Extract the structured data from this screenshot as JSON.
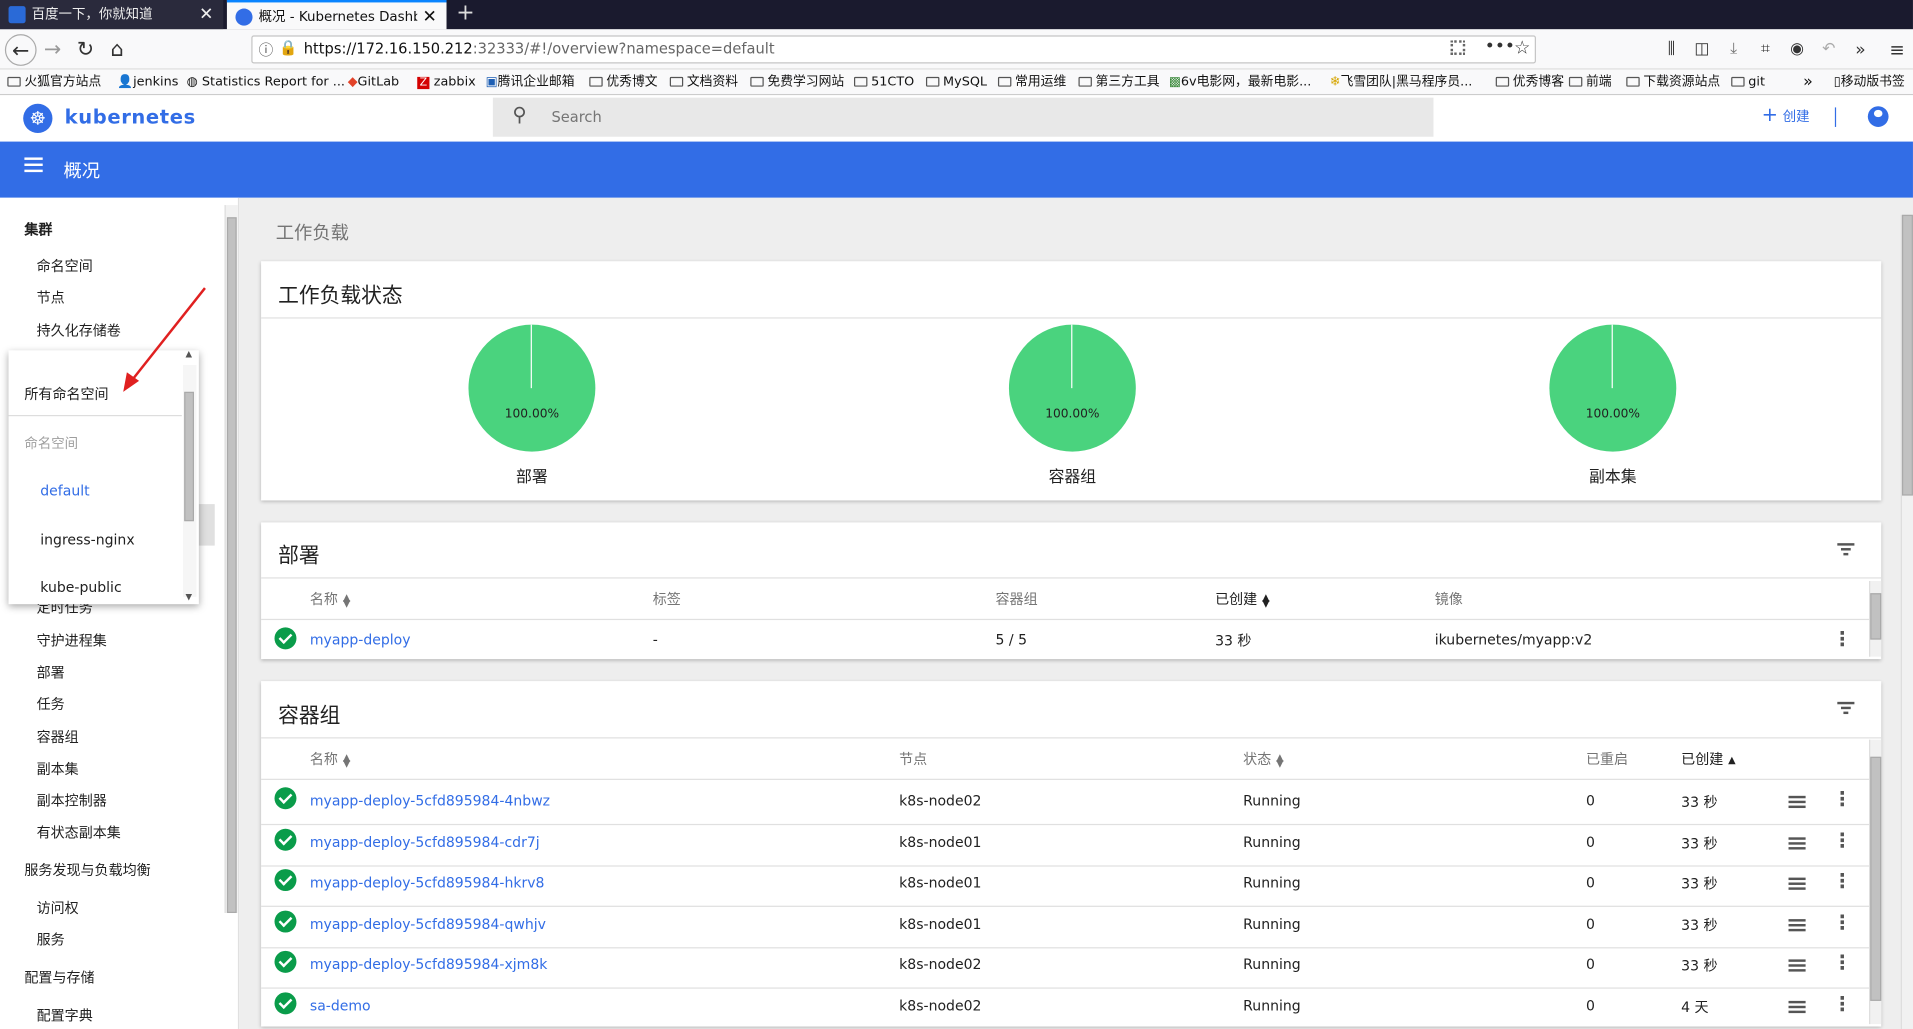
{
  "browser": {
    "tabs": [
      {
        "label": "百度一下，你就知道",
        "active": false
      },
      {
        "label": "概况 - Kubernetes Dashboard",
        "active": true
      }
    ],
    "url_host": "https://172.16.150.212",
    "url_rest": ":32333/#!/overview?namespace=default",
    "bookmarks": [
      "火狐官方站点",
      "jenkins",
      "Statistics Report for ...",
      "GitLab",
      "zabbix",
      "腾讯企业邮箱",
      "优秀博文",
      "文档资料",
      "免费学习网站",
      "51CTO",
      "MySQL",
      "常用运维",
      "第三方工具",
      "6v电影网，最新电影...",
      "飞雪团队|黑马程序员...",
      "优秀博客",
      "前端",
      "下载资源站点",
      "git"
    ],
    "mobile_bookmarks": "移动版书签"
  },
  "app": {
    "brand": "kubernetes",
    "search_placeholder": "Search",
    "create_label": "创建",
    "page_title": "概况",
    "accent": "#326de6"
  },
  "sidebar": {
    "groups": [
      {
        "label": "集群",
        "items": [
          "命名空间",
          "节点",
          "持久化存储卷"
        ]
      },
      {
        "label": "",
        "items": [
          "定时任务",
          "守护进程集",
          "部署",
          "任务",
          "容器组",
          "副本集",
          "副本控制器",
          "有状态副本集"
        ]
      },
      {
        "label": "服务发现与负载均衡",
        "items": [
          "访问权",
          "服务"
        ]
      },
      {
        "label": "配置与存储",
        "items": [
          "配置字典"
        ]
      }
    ]
  },
  "namespace_dropdown": {
    "all_label": "所有命名空间",
    "section_label": "命名空间",
    "options": [
      "default",
      "ingress-nginx",
      "kube-public"
    ],
    "selected": "default"
  },
  "main": {
    "section_title": "工作负载",
    "status_card": {
      "title": "工作负载状态",
      "pies": [
        {
          "label": "部署",
          "percent_text": "100.00%",
          "value": 100
        },
        {
          "label": "容器组",
          "percent_text": "100.00%",
          "value": 100
        },
        {
          "label": "副本集",
          "percent_text": "100.00%",
          "value": 100
        }
      ]
    },
    "deployments": {
      "title": "部署",
      "columns": [
        "名称",
        "标签",
        "容器组",
        "已创建",
        "镜像"
      ],
      "rows": [
        {
          "name": "myapp-deploy",
          "labels": "-",
          "pods": "5 / 5",
          "created": "33 秒",
          "image": "ikubernetes/myapp:v2"
        }
      ]
    },
    "pods": {
      "title": "容器组",
      "columns": [
        "名称",
        "节点",
        "状态",
        "已重启",
        "已创建"
      ],
      "rows": [
        {
          "name": "myapp-deploy-5cfd895984-4nbwz",
          "node": "k8s-node02",
          "status": "Running",
          "restarts": "0",
          "created": "33 秒"
        },
        {
          "name": "myapp-deploy-5cfd895984-cdr7j",
          "node": "k8s-node01",
          "status": "Running",
          "restarts": "0",
          "created": "33 秒"
        },
        {
          "name": "myapp-deploy-5cfd895984-hkrv8",
          "node": "k8s-node01",
          "status": "Running",
          "restarts": "0",
          "created": "33 秒"
        },
        {
          "name": "myapp-deploy-5cfd895984-qwhjv",
          "node": "k8s-node01",
          "status": "Running",
          "restarts": "0",
          "created": "33 秒"
        },
        {
          "name": "myapp-deploy-5cfd895984-xjm8k",
          "node": "k8s-node02",
          "status": "Running",
          "restarts": "0",
          "created": "33 秒"
        },
        {
          "name": "sa-demo",
          "node": "k8s-node02",
          "status": "Running",
          "restarts": "0",
          "created": "4 天"
        }
      ]
    }
  }
}
